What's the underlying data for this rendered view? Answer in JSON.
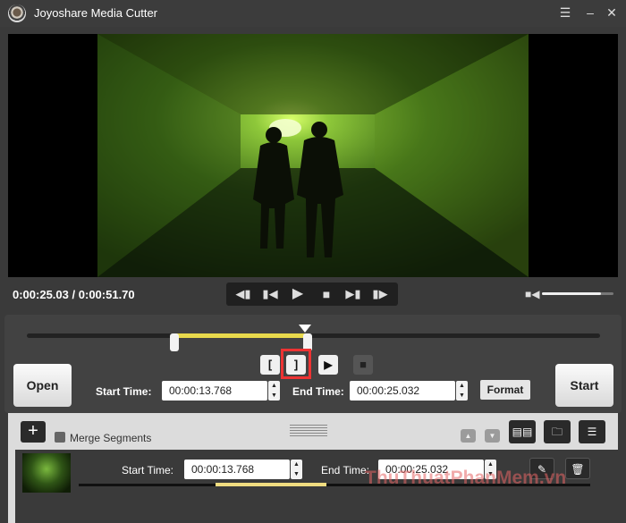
{
  "app": {
    "title": "Joyoshare Media Cutter"
  },
  "player": {
    "current_time": "0:00:25.03",
    "total_time": "0:00:51.70",
    "time_separator": "/",
    "volume_level": 0.82,
    "controls": [
      "previous-segment",
      "previous-frame",
      "play",
      "stop",
      "next-frame",
      "next-segment"
    ]
  },
  "timeline": {
    "segment_start_fraction": 0.266,
    "segment_end_fraction": 0.484,
    "playhead_fraction": 0.484
  },
  "edit": {
    "open_label": "Open",
    "start_label": "Start",
    "start_time_label": "Start Time:",
    "start_time_value": "00:00:13.768",
    "end_time_label": "End Time:",
    "end_time_value": "00:00:25.032",
    "format_label": "Format",
    "mark_in_glyph": "[",
    "mark_out_glyph": "]"
  },
  "list": {
    "merge_label": "Merge Segments",
    "segment": {
      "start_time_label": "Start Time:",
      "start_time_value": "00:00:13.768",
      "end_time_label": "End Time:",
      "end_time_value": "00:00:25.032"
    }
  },
  "watermark": {
    "text": "ThuThuatPhanMem.vn"
  },
  "colors": {
    "accent_yellow": "#e8d94c",
    "highlight_red": "#e33333",
    "background": "#3a3a3a"
  }
}
